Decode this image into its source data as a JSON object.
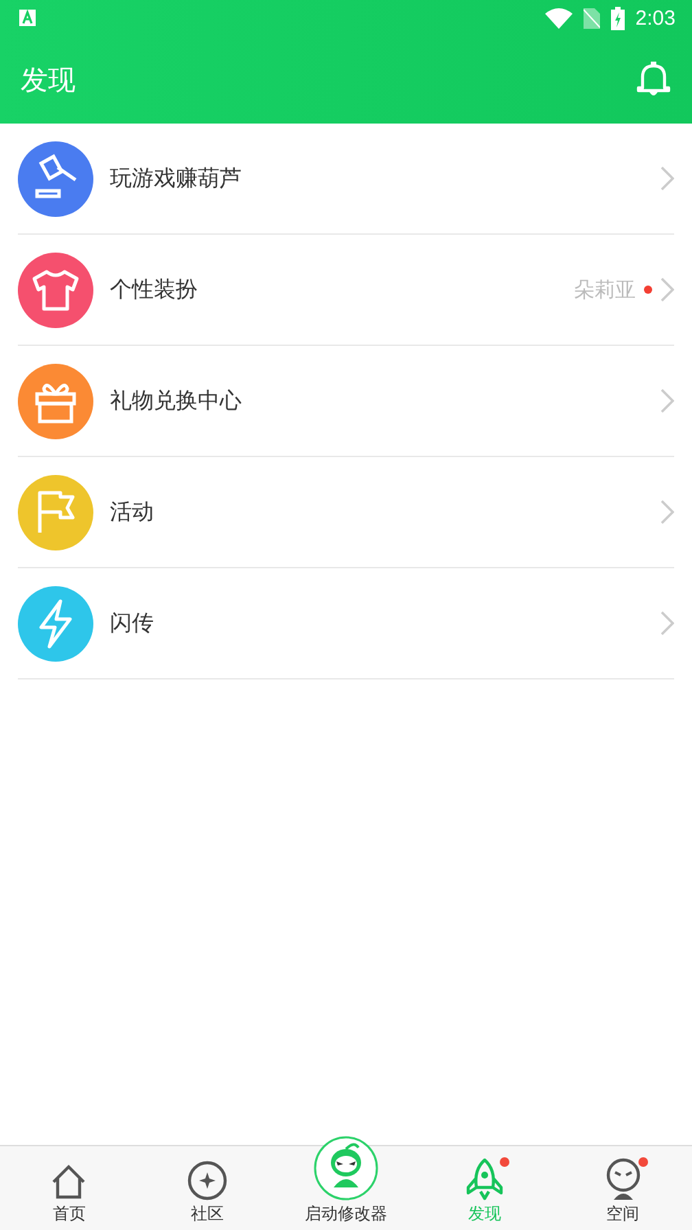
{
  "status_bar": {
    "time": "2:03"
  },
  "app_bar": {
    "title": "发现"
  },
  "items": [
    {
      "label": "玩游戏赚葫芦",
      "color": "#4a7cf0",
      "badge": false
    },
    {
      "label": "个性装扮",
      "color": "#f5506e",
      "detail": "朵莉亚",
      "badge": true
    },
    {
      "label": "礼物兑换中心",
      "color": "#fb8a34",
      "badge": false
    },
    {
      "label": "活动",
      "color": "#eec52c",
      "badge": false
    },
    {
      "label": "闪传",
      "color": "#2ec6ea",
      "badge": false
    }
  ],
  "nav": [
    {
      "label": "首页",
      "selected": false,
      "badge": false
    },
    {
      "label": "社区",
      "selected": false,
      "badge": false
    },
    {
      "label": "启动修改器",
      "selected": false,
      "badge": false
    },
    {
      "label": "发现",
      "selected": true,
      "badge": true
    },
    {
      "label": "空间",
      "selected": false,
      "badge": true
    }
  ]
}
